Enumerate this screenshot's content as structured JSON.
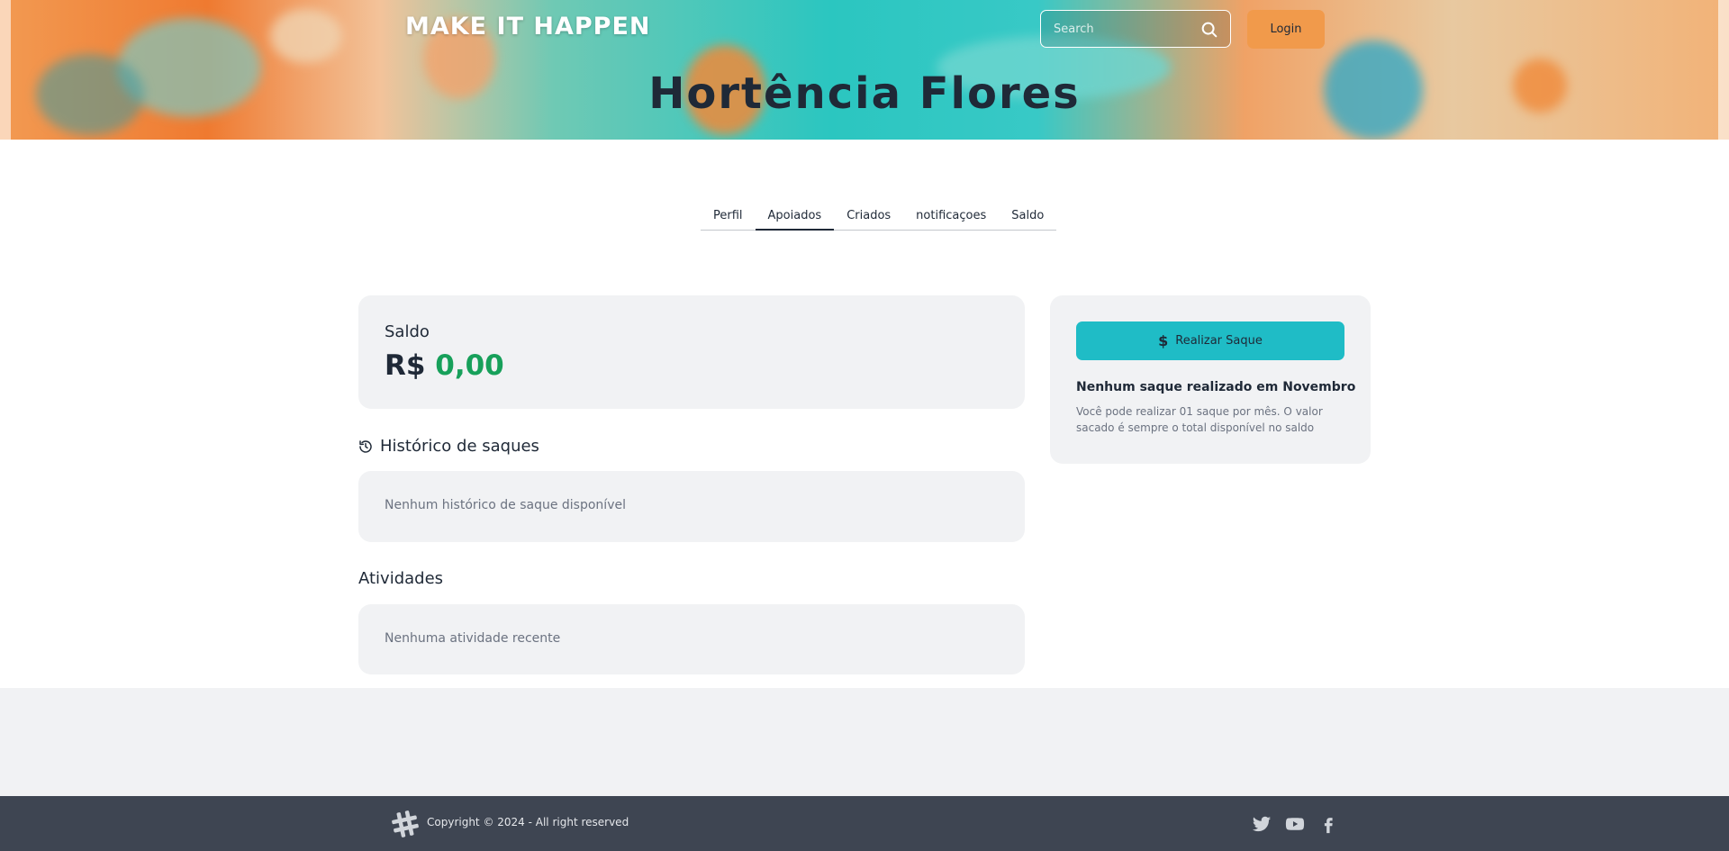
{
  "header": {
    "brand": "MAKE IT HAPPEN",
    "search_placeholder": "Search",
    "login_label": "Login",
    "title": "Hortência Flores"
  },
  "tabs": [
    {
      "label": "Perfil",
      "active": false
    },
    {
      "label": "Apoiados",
      "active": true
    },
    {
      "label": "Criados",
      "active": false
    },
    {
      "label": "notificaçoes",
      "active": false
    },
    {
      "label": "Saldo",
      "active": false
    }
  ],
  "balance": {
    "label": "Saldo",
    "currency": "R$",
    "value": "0,00"
  },
  "history": {
    "title": "Histórico de saques",
    "empty": "Nenhum histórico de saque disponível"
  },
  "activities": {
    "title": "Atividades",
    "empty": "Nenhuma atividade recente"
  },
  "withdraw": {
    "button_label": "Realizar Saque",
    "headline": "Nenhum saque realizado em Novembro",
    "description": "Você pode realizar 01 saque por mês. O valor sacado é sempre o total disponível no saldo"
  },
  "footer": {
    "copyright": "Copyright © 2024 - All right reserved",
    "social_icons": [
      "twitter-icon",
      "youtube-icon",
      "facebook-icon"
    ]
  },
  "colors": {
    "accent_teal": "#1fbcc6",
    "login_orange": "#f19a4b",
    "balance_green": "#17a05a",
    "footer_bg": "#3e4552",
    "card_bg": "#f1f2f4"
  },
  "icons": {
    "search": "search-icon",
    "history": "history-icon",
    "dollar": "dollar-icon",
    "footer_logo": "hashtag-logo-icon"
  }
}
